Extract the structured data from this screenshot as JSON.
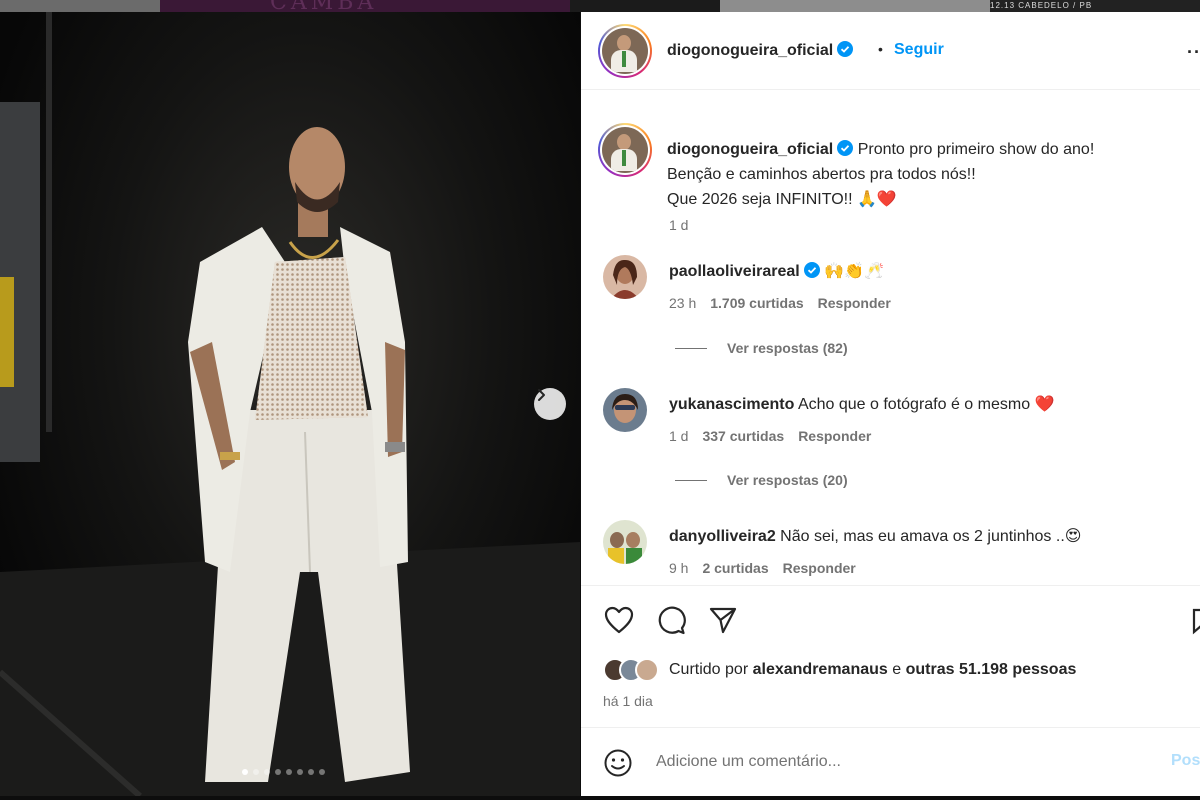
{
  "background": {
    "tile_text_1": "CAMBA",
    "tile_text_2": "12.13 CABEDELO / PB"
  },
  "media": {
    "carousel_count": 8,
    "active_index": 0
  },
  "header": {
    "username": "diogonogueira_oficial",
    "separator": "•",
    "follow_label": "Seguir",
    "more_label": "···"
  },
  "caption": {
    "username": "diogonogueira_oficial",
    "line1": "Pronto pro primeiro show do ano!",
    "line2": "Benção e caminhos abertos pra todos nós!!",
    "line3": "Que 2026 seja INFINITO!! 🙏❤️",
    "time": "1 d"
  },
  "comments": [
    {
      "username": "paollaoliveirareal",
      "verified": true,
      "text": "🙌👏🥂",
      "time": "23 h",
      "likes": "1.709 curtidas",
      "reply_label": "Responder",
      "view_replies": "Ver respostas (82)"
    },
    {
      "username": "yukanascimento",
      "verified": false,
      "text": "Acho que o fotógrafo é o mesmo ❤️",
      "time": "1 d",
      "likes": "337 curtidas",
      "reply_label": "Responder",
      "view_replies": "Ver respostas (20)"
    },
    {
      "username": "danyolliveira2",
      "verified": false,
      "text": "Não sei, mas eu amava os 2 juntinhos ..😍",
      "time": "9 h",
      "likes": "2 curtidas",
      "reply_label": "Responder"
    }
  ],
  "likes": {
    "prefix": "Curtido por",
    "user": "alexandremanaus",
    "middle": "e",
    "others": "outras 51.198 pessoas"
  },
  "posted_ago": "há 1 dia",
  "composer": {
    "placeholder": "Adicione um comentário...",
    "post_label": "Pos"
  },
  "colors": {
    "accent": "#0095f6",
    "verified": "#0095f6",
    "secondary_text": "#737373",
    "post_disabled": "#b2dffc"
  }
}
